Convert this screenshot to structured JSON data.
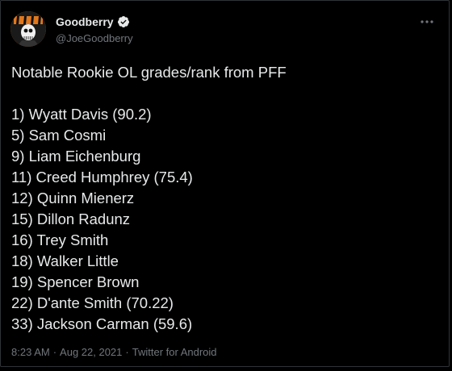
{
  "author": {
    "display_name": "Goodberry",
    "handle": "@JoeGoodberry",
    "verified": true
  },
  "icons": {
    "verified": "verified-badge-icon",
    "more": "more-options-icon",
    "avatar": "bengals-skeleton-avatar"
  },
  "colors": {
    "background": "#000000",
    "text_primary": "#e7e9ea",
    "text_secondary": "#71767b",
    "border": "#2f3336"
  },
  "tweet": {
    "intro": "Notable Rookie OL grades/rank from PFF",
    "rankings": [
      "1) Wyatt Davis (90.2)",
      "5) Sam Cosmi",
      "9) Liam Eichenburg",
      "11) Creed Humphrey (75.4)",
      "12) Quinn Mienerz",
      "15) Dillon Radunz",
      "16) Trey Smith",
      "18) Walker Little",
      "19) Spencer Brown",
      "22) D'ante Smith (70.22)",
      "33) Jackson Carman (59.6)"
    ]
  },
  "meta": {
    "time": "8:23 AM",
    "separator": "·",
    "date": "Aug 22, 2021",
    "source": "Twitter for Android"
  }
}
